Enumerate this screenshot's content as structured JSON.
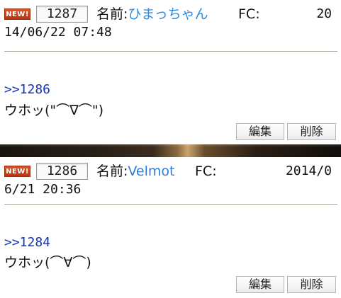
{
  "posts": [
    {
      "new_badge": "NEW!",
      "number": "1287",
      "name_label": "名前:",
      "name": "ひまっちゃん",
      "fc_label": "FC:",
      "date_start": "20",
      "date_rest": "14/06/22 07:48",
      "reply_link": ">>1286",
      "message": "ウホッ(\"⌒∇⌒\")",
      "edit_label": "編集",
      "delete_label": "削除"
    },
    {
      "new_badge": "NEW!",
      "number": "1286",
      "name_label": "名前:",
      "name": "Velmot",
      "fc_label": "FC:",
      "date_start": "2014/0",
      "date_rest": "6/21 20:36",
      "reply_link": ">>1284",
      "message": "ウホッ(⌒∀⌒)",
      "edit_label": "編集",
      "delete_label": "削除"
    }
  ],
  "colors": {
    "new_badge": "#c9401a",
    "name_link": "#2a8be0",
    "reply_link": "#1830b8",
    "divider": "#a9a596"
  }
}
